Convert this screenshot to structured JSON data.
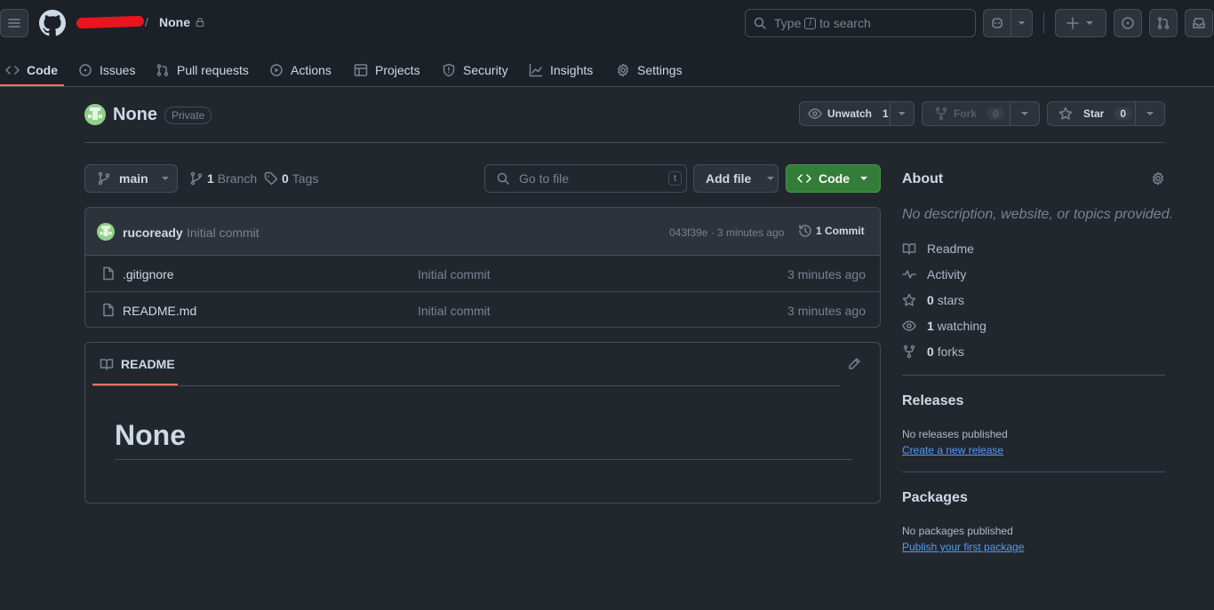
{
  "header": {
    "owner_redacted": "",
    "repo_name": "None",
    "search_placeholder_prefix": "Type",
    "search_key": "/",
    "search_placeholder_suffix": "to search"
  },
  "tabs": [
    {
      "label": "Code",
      "active": true
    },
    {
      "label": "Issues"
    },
    {
      "label": "Pull requests"
    },
    {
      "label": "Actions"
    },
    {
      "label": "Projects"
    },
    {
      "label": "Security"
    },
    {
      "label": "Insights"
    },
    {
      "label": "Settings"
    }
  ],
  "repo": {
    "title": "None",
    "visibility": "Private",
    "unwatch_label": "Unwatch",
    "watch_count": "1",
    "fork_label": "Fork",
    "fork_count": "0",
    "star_label": "Star",
    "star_count": "0"
  },
  "toolbar": {
    "branch": "main",
    "branch_count": "1",
    "branch_label": "Branch",
    "tag_count": "0",
    "tag_label": "Tags",
    "goto_placeholder": "Go to file",
    "goto_key": "t",
    "add_file": "Add file",
    "code": "Code"
  },
  "commit": {
    "author": "rucoready",
    "message": "Initial commit",
    "meta": "043f39e · 3 minutes ago",
    "count_label": "1 Commit"
  },
  "files": [
    {
      "name": ".gitignore",
      "message": "Initial commit",
      "time": "3 minutes ago"
    },
    {
      "name": "README.md",
      "message": "Initial commit",
      "time": "3 minutes ago"
    }
  ],
  "readme": {
    "tab_label": "README",
    "heading": "None"
  },
  "about": {
    "title": "About",
    "description": "No description, website, or topics provided.",
    "readme": "Readme",
    "activity": "Activity",
    "stars_count": "0",
    "stars_label": "stars",
    "watching_count": "1",
    "watching_label": "watching",
    "forks_count": "0",
    "forks_label": "forks"
  },
  "releases": {
    "title": "Releases",
    "text": "No releases published",
    "link": "Create a new release"
  },
  "packages": {
    "title": "Packages",
    "text": "No packages published",
    "link": "Publish your first package"
  },
  "colors": {
    "background": "#22272e",
    "header": "#1c2128",
    "accent_tab": "#ec775c",
    "primary_button": "#347d39",
    "link": "#539bf5"
  }
}
